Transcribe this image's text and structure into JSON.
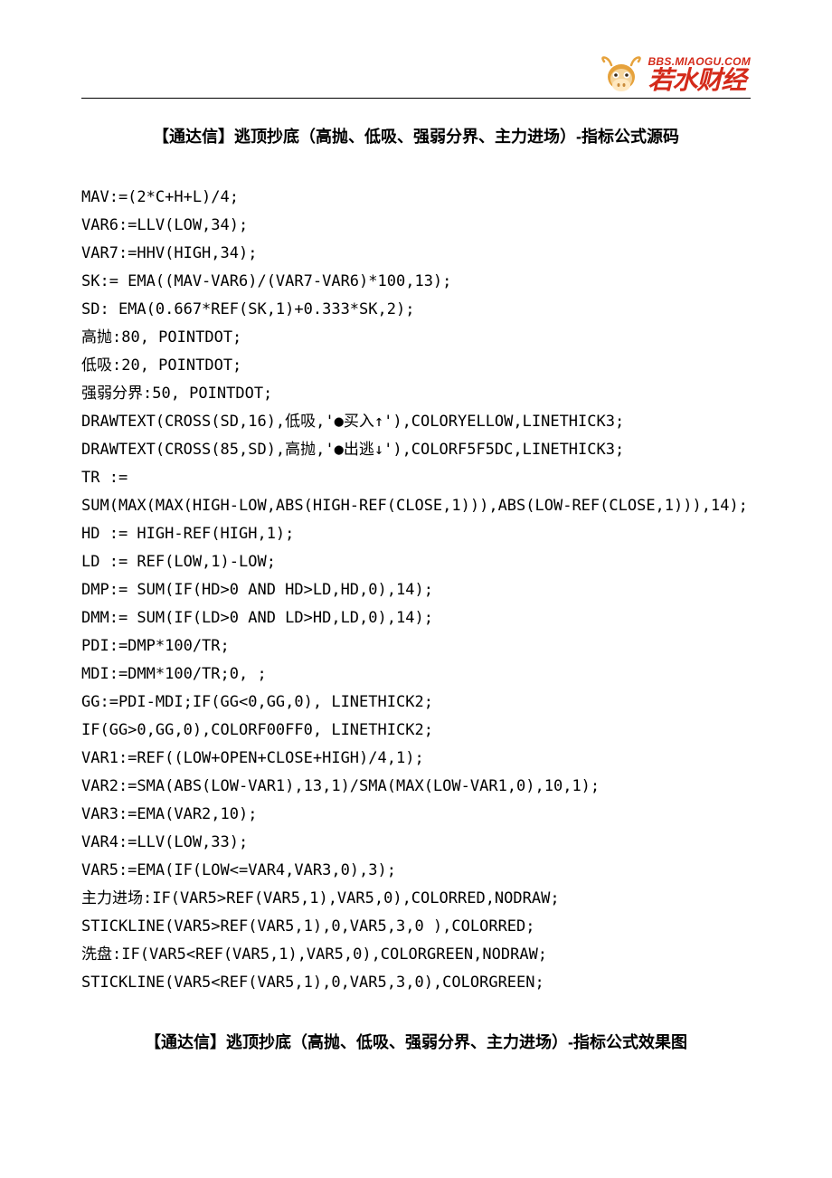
{
  "logo": {
    "url": "BBS.MIAOGU.COM",
    "cn": "若水财经"
  },
  "title": "【通达信】逃顶抄底（高抛、低吸、强弱分界、主力进场）-指标公式源码",
  "title2": "【通达信】逃顶抄底（高抛、低吸、强弱分界、主力进场）-指标公式效果图",
  "code_lines": [
    "MAV:=(2*C+H+L)/4;",
    "VAR6:=LLV(LOW,34);",
    "VAR7:=HHV(HIGH,34);",
    "SK:= EMA((MAV-VAR6)/(VAR7-VAR6)*100,13);",
    "SD: EMA(0.667*REF(SK,1)+0.333*SK,2);",
    "高抛:80, POINTDOT;",
    "低吸:20, POINTDOT;",
    "强弱分界:50, POINTDOT;",
    "DRAWTEXT(CROSS(SD,16),低吸,'●买入↑'),COLORYELLOW,LINETHICK3;",
    "DRAWTEXT(CROSS(85,SD),高抛,'●出逃↓'),COLORF5F5DC,LINETHICK3;",
    "TR :=",
    "SUM(MAX(MAX(HIGH-LOW,ABS(HIGH-REF(CLOSE,1))),ABS(LOW-REF(CLOSE,1))),14);",
    "HD := HIGH-REF(HIGH,1);",
    "LD := REF(LOW,1)-LOW;",
    "DMP:= SUM(IF(HD>0 AND HD>LD,HD,0),14);",
    "DMM:= SUM(IF(LD>0 AND LD>HD,LD,0),14);",
    "PDI:=DMP*100/TR;",
    "MDI:=DMM*100/TR;0, ;",
    "GG:=PDI-MDI;IF(GG<0,GG,0), LINETHICK2;",
    "IF(GG>0,GG,0),COLORF00FF0, LINETHICK2;",
    "VAR1:=REF((LOW+OPEN+CLOSE+HIGH)/4,1);",
    "VAR2:=SMA(ABS(LOW-VAR1),13,1)/SMA(MAX(LOW-VAR1,0),10,1);",
    "VAR3:=EMA(VAR2,10);",
    "VAR4:=LLV(LOW,33);",
    "VAR5:=EMA(IF(LOW<=VAR4,VAR3,0),3);",
    "主力进场:IF(VAR5>REF(VAR5,1),VAR5,0),COLORRED,NODRAW;",
    "STICKLINE(VAR5>REF(VAR5,1),0,VAR5,3,0 ),COLORRED;",
    "洗盘:IF(VAR5<REF(VAR5,1),VAR5,0),COLORGREEN,NODRAW;",
    "STICKLINE(VAR5<REF(VAR5,1),0,VAR5,3,0),COLORGREEN;"
  ]
}
